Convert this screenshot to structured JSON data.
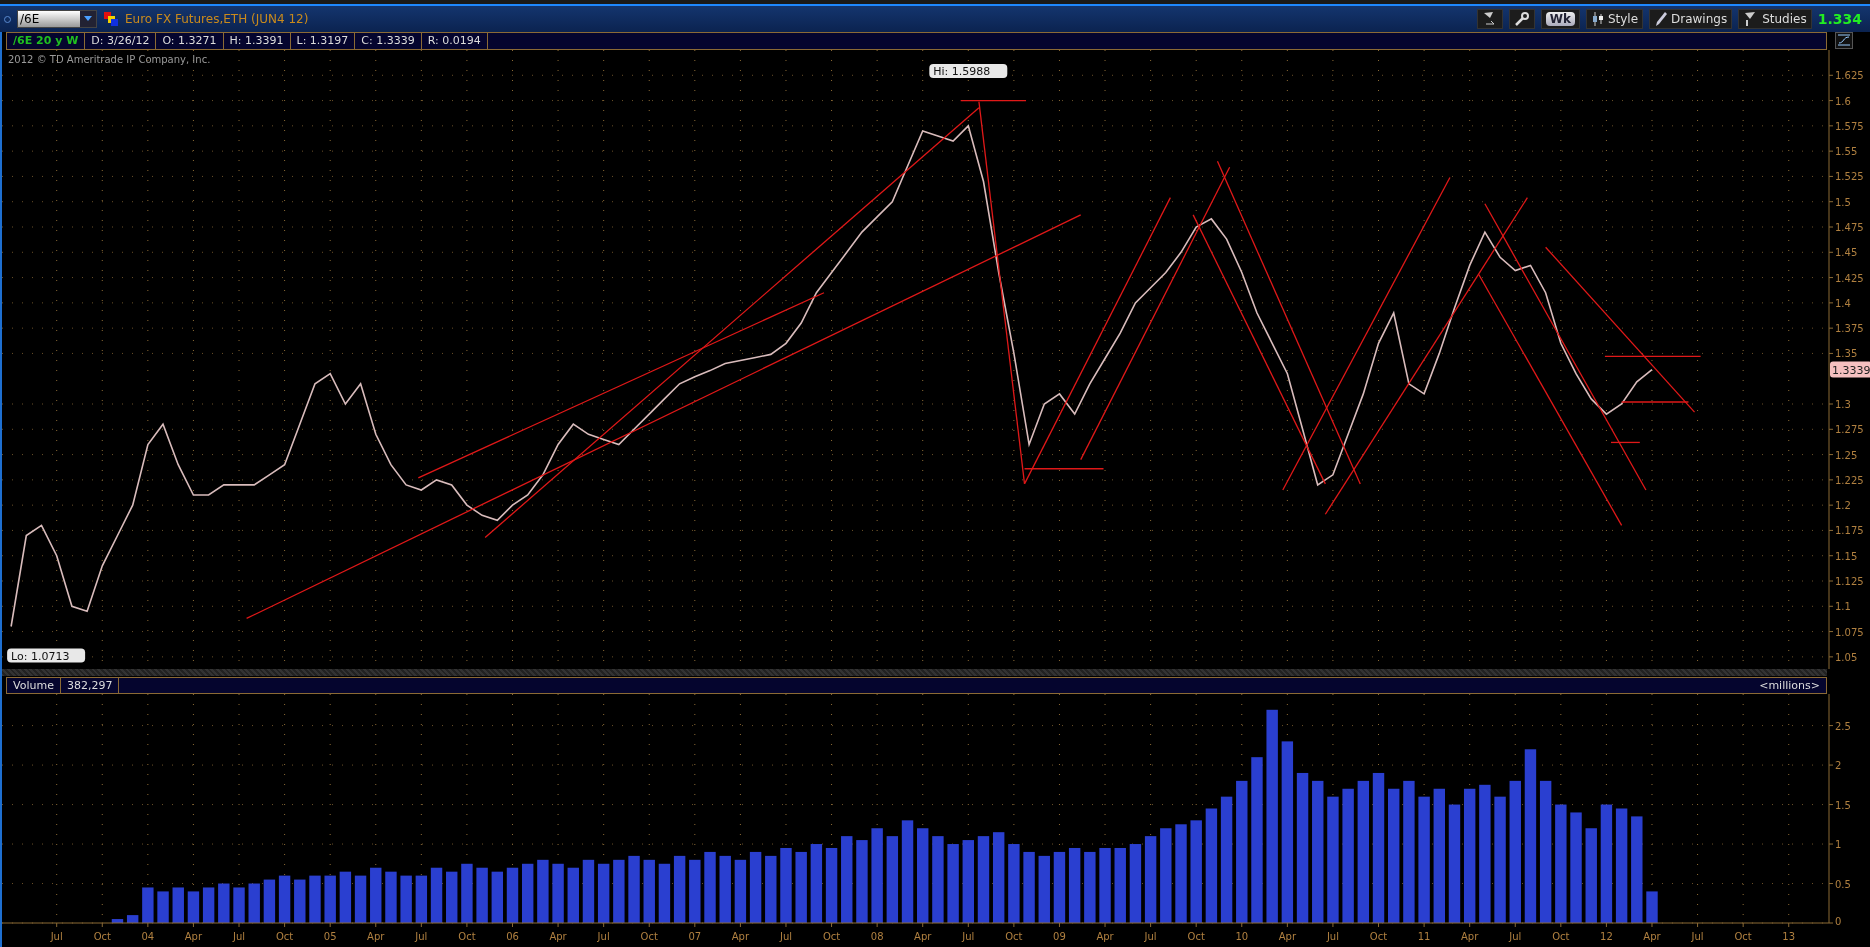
{
  "toolbar": {
    "symbol": "/6E",
    "title": "Euro FX Futures,ETH (JUN4 12)",
    "buttons": [
      {
        "kind": "studies_icon"
      },
      {
        "kind": "wrench"
      },
      {
        "kind": "period",
        "label": "Wk"
      },
      {
        "kind": "style",
        "label": "Style"
      },
      {
        "kind": "drawings",
        "label": "Drawings"
      },
      {
        "kind": "studies",
        "label": "Studies"
      }
    ],
    "last": "1.334"
  },
  "info": {
    "symbol_label": "/6E 20 y W",
    "fields": [
      "D: 3/26/12",
      "O: 1.3271",
      "H: 1.3391",
      "L: 1.3197",
      "C: 1.3339",
      "R: 0.0194"
    ]
  },
  "price_pane": {
    "copyright": "2012 © TD Ameritrade IP Company, Inc.",
    "last_price_tag": "1.3339",
    "high_label": "Hi: 1.5988",
    "low_label": "Lo: 1.0713",
    "chart_data": {
      "type": "line",
      "grid": true,
      "ylim": [
        1.038,
        1.65
      ],
      "yticks": [
        {
          "value": 1.05,
          "label": "1.05"
        },
        {
          "value": 1.075,
          "label": "1.075"
        },
        {
          "value": 1.1,
          "label": "1.1"
        },
        {
          "value": 1.125,
          "label": "1.125"
        },
        {
          "value": 1.15,
          "label": "1.15"
        },
        {
          "value": 1.175,
          "label": "1.175"
        },
        {
          "value": 1.2,
          "label": "1.2"
        },
        {
          "value": 1.225,
          "label": "1.225"
        },
        {
          "value": 1.25,
          "label": "1.25"
        },
        {
          "value": 1.275,
          "label": "1.275"
        },
        {
          "value": 1.3,
          "label": "1.3"
        },
        {
          "value": 1.35,
          "label": "1.35"
        },
        {
          "value": 1.375,
          "label": "1.375"
        },
        {
          "value": 1.4,
          "label": "1.4"
        },
        {
          "value": 1.425,
          "label": "1.425"
        },
        {
          "value": 1.45,
          "label": "1.45"
        },
        {
          "value": 1.475,
          "label": "1.475"
        },
        {
          "value": 1.5,
          "label": "1.5"
        },
        {
          "value": 1.525,
          "label": "1.525"
        },
        {
          "value": 1.55,
          "label": "1.55"
        },
        {
          "value": 1.575,
          "label": "1.575"
        },
        {
          "value": 1.6,
          "label": "1.6"
        },
        {
          "value": 1.625,
          "label": "1.625"
        }
      ],
      "categories": [
        null,
        null,
        null,
        null,
        null,
        null,
        null,
        null,
        null,
        null,
        null,
        null,
        null,
        null,
        null,
        null,
        null,
        null,
        null,
        null,
        null,
        null,
        null,
        null,
        null,
        null,
        null,
        null,
        null,
        null,
        null,
        null,
        null,
        null,
        null,
        null,
        null,
        null,
        null,
        null,
        null,
        null,
        null,
        null,
        null,
        null,
        null,
        null,
        null,
        null,
        null,
        null,
        null,
        null,
        null,
        null,
        null,
        null,
        null,
        null,
        null,
        null,
        null,
        null,
        null,
        null,
        null,
        null,
        null,
        null,
        null,
        null,
        null,
        null,
        null,
        null,
        null,
        null,
        null,
        null,
        null,
        null,
        null,
        null,
        null,
        null,
        null,
        null,
        null,
        null,
        null,
        null,
        null,
        null,
        null,
        null,
        null,
        null,
        null,
        null,
        null,
        null,
        null,
        null,
        null,
        null,
        null,
        null,
        null,
        null,
        null,
        null,
        null,
        null,
        null,
        null,
        null,
        null,
        null,
        null
      ],
      "series": [
        {
          "color": "#d9bcbc",
          "values": [
            1.08,
            1.17,
            1.18,
            1.15,
            1.1,
            1.095,
            1.14,
            1.17,
            1.2,
            1.26,
            1.28,
            1.24,
            1.21,
            1.21,
            1.22,
            1.22,
            1.22,
            1.23,
            1.24,
            1.28,
            1.32,
            1.33,
            1.3,
            1.32,
            1.27,
            1.24,
            1.22,
            1.215,
            1.225,
            1.22,
            1.2,
            1.19,
            1.185,
            1.2,
            1.21,
            1.23,
            1.26,
            1.28,
            1.27,
            1.265,
            1.26,
            1.275,
            1.29,
            1.305,
            1.32,
            1.327,
            1.333,
            1.34,
            1.343,
            1.346,
            1.349,
            1.36,
            1.38,
            1.41,
            1.43,
            1.45,
            1.47,
            1.485,
            1.5,
            1.535,
            1.57,
            1.565,
            1.56,
            1.575,
            1.52,
            1.43,
            1.35,
            1.26,
            1.3,
            1.31,
            1.29,
            1.32,
            1.345,
            1.37,
            1.4,
            1.415,
            1.43,
            1.45,
            1.475,
            1.483,
            1.463,
            1.43,
            1.39,
            1.36,
            1.33,
            1.275,
            1.22,
            1.23,
            1.27,
            1.31,
            1.36,
            1.39,
            1.32,
            1.31,
            1.35,
            1.395,
            1.437,
            1.47,
            1.445,
            1.432,
            1.437,
            1.41,
            1.36,
            1.33,
            1.305,
            1.29,
            1.3,
            1.322,
            1.334,
            null,
            null,
            null,
            null,
            null,
            null,
            null,
            null,
            null,
            null,
            null
          ]
        }
      ]
    }
  },
  "volume_pane": {
    "value": "382,297",
    "units": "<millions>",
    "chart_data": {
      "type": "bar",
      "grid": true,
      "ylim": [
        0,
        2.9
      ],
      "categories": [
        null,
        null,
        null,
        "Jul",
        null,
        null,
        "Oct",
        null,
        null,
        "04",
        null,
        null,
        "Apr",
        null,
        null,
        "Jul",
        null,
        null,
        "Oct",
        null,
        null,
        "05",
        null,
        null,
        "Apr",
        null,
        null,
        "Jul",
        null,
        null,
        "Oct",
        null,
        null,
        "06",
        null,
        null,
        "Apr",
        null,
        null,
        "Jul",
        null,
        null,
        "Oct",
        null,
        null,
        "07",
        null,
        null,
        "Apr",
        null,
        null,
        "Jul",
        null,
        null,
        "Oct",
        null,
        null,
        "08",
        null,
        null,
        "Apr",
        null,
        null,
        "Jul",
        null,
        null,
        "Oct",
        null,
        null,
        "09",
        null,
        null,
        "Apr",
        null,
        null,
        "Jul",
        null,
        null,
        "Oct",
        null,
        null,
        "10",
        null,
        null,
        "Apr",
        null,
        null,
        "Jul",
        null,
        null,
        "Oct",
        null,
        null,
        "11",
        null,
        null,
        "Apr",
        null,
        null,
        "Jul",
        null,
        null,
        "Oct",
        null,
        null,
        "12",
        null,
        null,
        "Apr",
        null,
        null,
        "Jul",
        null,
        null,
        "Oct",
        null,
        null,
        "13",
        null,
        null
      ],
      "yticks": [
        {
          "value": 0,
          "label": "0"
        },
        {
          "value": 0.5,
          "label": "0.5"
        },
        {
          "value": 1,
          "label": "1"
        },
        {
          "value": 1.5,
          "label": "1.5"
        },
        {
          "value": 2,
          "label": "2"
        },
        {
          "value": 2.5,
          "label": "2.5"
        }
      ],
      "series": [
        {
          "name": "Volume",
          "color": "#2a3fd0",
          "values": [
            null,
            null,
            null,
            null,
            null,
            null,
            null,
            0.05,
            0.1,
            0.45,
            0.4,
            0.45,
            0.4,
            0.45,
            0.5,
            0.45,
            0.5,
            0.55,
            0.6,
            0.55,
            0.6,
            0.6,
            0.65,
            0.6,
            0.7,
            0.65,
            0.6,
            0.6,
            0.7,
            0.65,
            0.75,
            0.7,
            0.65,
            0.7,
            0.75,
            0.8,
            0.75,
            0.7,
            0.8,
            0.75,
            0.8,
            0.85,
            0.8,
            0.75,
            0.85,
            0.8,
            0.9,
            0.85,
            0.8,
            0.9,
            0.85,
            0.95,
            0.9,
            1.0,
            0.95,
            1.1,
            1.05,
            1.2,
            1.1,
            1.3,
            1.2,
            1.1,
            1.0,
            1.05,
            1.1,
            1.15,
            1.0,
            0.9,
            0.85,
            0.9,
            0.95,
            0.9,
            0.95,
            0.95,
            1.0,
            1.1,
            1.2,
            1.25,
            1.3,
            1.45,
            1.6,
            1.8,
            2.1,
            2.7,
            2.3,
            1.9,
            1.8,
            1.6,
            1.7,
            1.8,
            1.9,
            1.7,
            1.8,
            1.6,
            1.7,
            1.5,
            1.7,
            1.75,
            1.6,
            1.8,
            2.2,
            1.8,
            1.5,
            1.4,
            1.2,
            1.5,
            1.45,
            1.35,
            0.4,
            null,
            null,
            null,
            null,
            null,
            null,
            null,
            null,
            null,
            null,
            null
          ]
        }
      ]
    }
  }
}
